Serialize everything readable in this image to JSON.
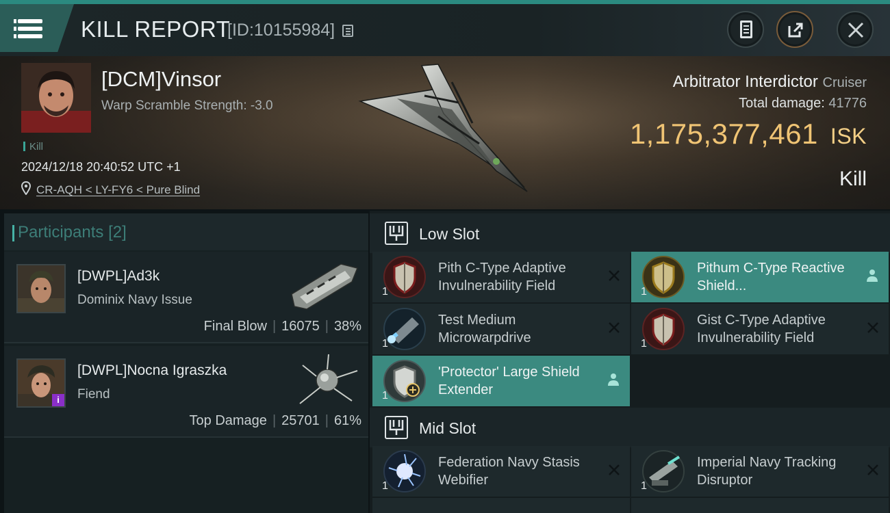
{
  "header": {
    "title": "KILL REPORT",
    "id_label": "[ID:10155984]",
    "buttons": {
      "menu": "menu-icon",
      "report": "document-icon",
      "share": "share-icon",
      "close": "close-icon"
    }
  },
  "victim": {
    "name": "[DCM]Vinsor",
    "subtitle": "Warp Scramble Strength: -3.0",
    "tag": "Kill",
    "timestamp": "2024/12/18 20:40:52 UTC +1",
    "location": "CR-AQH < LY-FY6 < Pure Blind",
    "ship_name": "Arbitrator Interdictor",
    "ship_class": "Cruiser",
    "total_damage_label": "Total damage:",
    "total_damage": "41776",
    "isk_value": "1,175,377,461",
    "isk_unit": "ISK",
    "result": "Kill"
  },
  "participants": {
    "title": "Participants",
    "count": "[2]",
    "items": [
      {
        "name": "[DWPL]Ad3k",
        "ship": "Dominix Navy Issue",
        "role": "Final Blow",
        "damage": "16075",
        "percent": "38%"
      },
      {
        "name": "[DWPL]Nocna Igraszka",
        "ship": "Fiend",
        "role": "Top Damage",
        "damage": "25701",
        "percent": "61%",
        "badge": "i"
      }
    ]
  },
  "slots": {
    "low": {
      "title": "Low Slot",
      "modules": [
        {
          "name": "Pith C-Type Adaptive Invulnerability Field",
          "qty": "1",
          "status": "destroyed"
        },
        {
          "name": "Pithum C-Type Reactive Shield...",
          "qty": "1",
          "status": "dropped"
        },
        {
          "name": "Test Medium Microwarpdrive",
          "qty": "1",
          "status": "destroyed"
        },
        {
          "name": "Gist C-Type Adaptive Invulnerability Field",
          "qty": "1",
          "status": "destroyed"
        },
        {
          "name": "'Protector' Large Shield Extender",
          "qty": "1",
          "status": "dropped"
        }
      ]
    },
    "mid": {
      "title": "Mid Slot",
      "modules": [
        {
          "name": "Federation Navy Stasis Webifier",
          "qty": "1",
          "status": "destroyed"
        },
        {
          "name": "Imperial Navy Tracking Disruptor",
          "qty": "1",
          "status": "destroyed"
        }
      ]
    }
  },
  "colors": {
    "accent_teal": "#3b8a80",
    "isk_gold": "#f0c474",
    "background": "#0d1416"
  }
}
